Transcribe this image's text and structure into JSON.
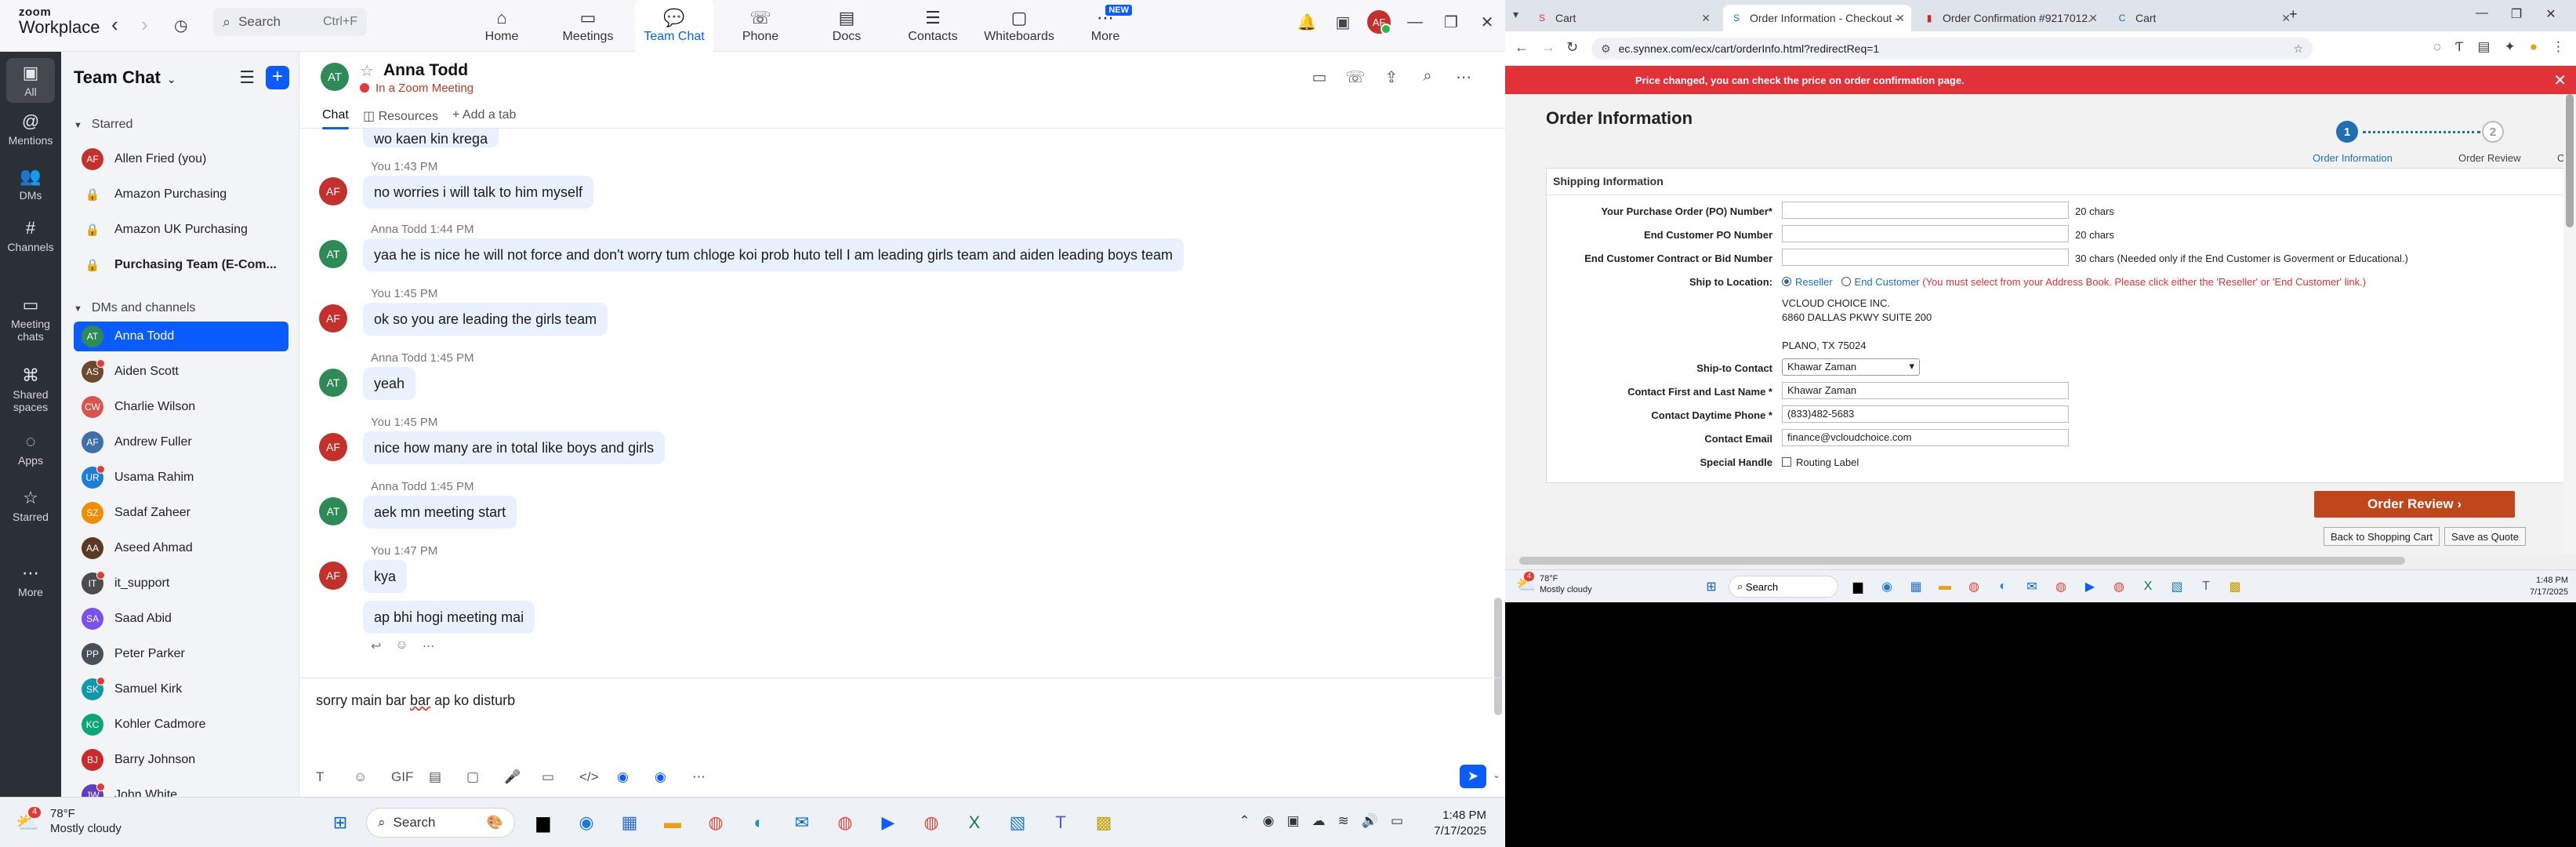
{
  "zoom": {
    "logo_line1": "zoom",
    "logo_line2": "Workplace",
    "search_placeholder": "Search",
    "search_shortcut": "Ctrl+F",
    "nav_tabs": [
      {
        "label": "Home",
        "icon": "⌂"
      },
      {
        "label": "Meetings",
        "icon": "▭"
      },
      {
        "label": "Team Chat",
        "icon": "💬"
      },
      {
        "label": "Phone",
        "icon": "☏"
      },
      {
        "label": "Docs",
        "icon": "▤"
      },
      {
        "label": "Contacts",
        "icon": "☰"
      },
      {
        "label": "Whiteboards",
        "icon": "▢"
      },
      {
        "label": "More",
        "icon": "⋯"
      }
    ],
    "new_badge": "NEW",
    "user_initials": "AF",
    "rail": [
      {
        "label": "All",
        "icon": "▣"
      },
      {
        "label": "Mentions",
        "icon": "@"
      },
      {
        "label": "DMs",
        "icon": "👥"
      },
      {
        "label": "Channels",
        "icon": "#"
      },
      {
        "label": "Meeting chats",
        "icon": "▭"
      },
      {
        "label": "Shared spaces",
        "icon": "⌘"
      },
      {
        "label": "Apps",
        "icon": "◌"
      },
      {
        "label": "Starred",
        "icon": "☆"
      },
      {
        "label": "More",
        "icon": "⋯"
      }
    ],
    "sidebar": {
      "title": "Team Chat",
      "sections": {
        "starred": "Starred",
        "dms": "DMs and channels"
      },
      "starred": [
        {
          "name": "Allen Fried (you)",
          "initials": "AF",
          "color": "#c4302b",
          "type": "avatar"
        },
        {
          "name": "Amazon Purchasing",
          "type": "lock"
        },
        {
          "name": "Amazon UK Purchasing",
          "type": "lock"
        },
        {
          "name": "Purchasing Team (E-Com...",
          "type": "lock",
          "bold": true
        }
      ],
      "dms": [
        {
          "name": "Anna Todd",
          "initials": "AT",
          "color": "#2e8b57",
          "active": true
        },
        {
          "name": "Aiden Scott",
          "initials": "AS",
          "color": "#6b4a2f"
        },
        {
          "name": "Charlie Wilson",
          "initials": "CW",
          "color": "#d9534f"
        },
        {
          "name": "Andrew Fuller",
          "initials": "AF",
          "color": "#3f6fa8"
        },
        {
          "name": "Usama Rahim",
          "initials": "UR",
          "color": "#1c7ed6"
        },
        {
          "name": "Sadaf Zaheer",
          "initials": "SZ",
          "color": "#f08c00"
        },
        {
          "name": "Aseed Ahmad",
          "initials": "AA",
          "color": "#5c3a21"
        },
        {
          "name": "it_support",
          "initials": "IT",
          "color": "#4c4c4c"
        },
        {
          "name": "Saad Abid",
          "initials": "SA",
          "color": "#7950f2"
        },
        {
          "name": "Peter Parker",
          "initials": "PP",
          "color": "#495057"
        },
        {
          "name": "Samuel Kirk",
          "initials": "SK",
          "color": "#1098ad"
        },
        {
          "name": "Kohler Cadmore",
          "initials": "KC",
          "color": "#0ca678"
        },
        {
          "name": "Barry Johnson",
          "initials": "BJ",
          "color": "#c92a2a"
        },
        {
          "name": "John White",
          "initials": "JW",
          "color": "#5f3dc4"
        }
      ]
    },
    "chat": {
      "contact_initials": "AT",
      "contact_name": "Anna Todd",
      "contact_status": "In a Zoom Meeting",
      "tabs": [
        "Chat",
        "Resources",
        "+ Add a tab"
      ],
      "messages": [
        {
          "meta": "",
          "text": "wo kaen kin krega",
          "from": "AT",
          "partial": true
        },
        {
          "meta": "You 1:43 PM",
          "text": "no worries i will talk to him myself",
          "from": "AF"
        },
        {
          "meta": "Anna Todd 1:44 PM",
          "text": "yaa he is nice he will not force and don't worry tum chloge koi prob huto tell I am leading girls team and aiden leading boys team",
          "from": "AT"
        },
        {
          "meta": "You 1:45 PM",
          "text": "ok so you are leading the girls team",
          "from": "AF"
        },
        {
          "meta": "Anna Todd 1:45 PM",
          "text": "yeah",
          "from": "AT"
        },
        {
          "meta": "You 1:45 PM",
          "text": "nice how many are in total like boys and girls",
          "from": "AF"
        },
        {
          "meta": "Anna Todd 1:45 PM",
          "text": "aek mn meeting start",
          "from": "AT"
        },
        {
          "meta": "You 1:47 PM",
          "text": "kya",
          "from": "AF"
        },
        {
          "meta": "",
          "text": "ap bhi hogi meeting mai",
          "from": "AF",
          "continued": true
        }
      ],
      "compose_before": "sorry main bar ",
      "compose_misspelled": "bar",
      "compose_after": " ap ko disturb",
      "compose_tools": [
        "T",
        "☺",
        "GIF",
        "▤",
        "▢",
        "🎤",
        "▭",
        "</>",
        "◉",
        "◉",
        "⋯"
      ]
    },
    "taskbar": {
      "weather_temp": "78°F",
      "weather_desc": "Mostly cloudy",
      "weather_badge": "4",
      "search": "Search",
      "time": "1:48 PM",
      "date": "7/17/2025"
    }
  },
  "browser": {
    "tabs": [
      {
        "title": "Cart",
        "active": false,
        "icon": "S",
        "color": "#e03238"
      },
      {
        "title": "Order Information - Checkout -",
        "active": true,
        "icon": "S",
        "color": "#1f6fb2"
      },
      {
        "title": "Order Confirmation #9217012...",
        "active": false,
        "icon": "▮",
        "color": "#c92a2a"
      },
      {
        "title": "Cart",
        "active": false,
        "icon": "C",
        "color": "#1f6fb2"
      }
    ],
    "url": "ec.synnex.com/ecx/cart/orderInfo.html?redirectReq=1",
    "banner": "Price changed, you can check the price on order confirmation page.",
    "page_title": "Order Information",
    "steps": [
      {
        "num": "1",
        "label": "Order Information"
      },
      {
        "num": "2",
        "label": "Order Review"
      },
      {
        "num": "",
        "label": "O"
      }
    ],
    "section_title": "Shipping Information",
    "fields": {
      "po_label": "Your Purchase Order (PO) Number*",
      "po_hint": "20 chars",
      "end_po_label": "End Customer PO Number",
      "end_po_hint": "20 chars",
      "contract_label": "End Customer Contract or Bid Number",
      "contract_hint": "30 chars (Needed only if the End Customer is Goverment or Educational.)",
      "ship_label": "Ship to Location:",
      "ship_opt1": "Reseller",
      "ship_opt2": "End Customer",
      "ship_note": "(You must select from your Address Book. Please click either the 'Reseller' or 'End Customer' link.)",
      "addr1": "VCLOUD CHOICE INC.",
      "addr2": "6860 DALLAS PKWY SUITE 200",
      "addr3": "PLANO, TX 75024",
      "contact_label": "Ship-to Contact",
      "contact_value": "Khawar Zaman",
      "name_label": "Contact First and Last Name *",
      "name_value": "Khawar Zaman",
      "phone_label": "Contact Daytime Phone *",
      "phone_value": "(833)482-5683",
      "email_label": "Contact Email",
      "email_value": "finance@vcloudchoice.com",
      "handle_label": "Special Handle",
      "handle_value": "Routing Label"
    },
    "btn_review": "Order Review ›",
    "btn_back": "Back to Shopping Cart",
    "btn_quote": "Save as Quote",
    "taskbar": {
      "weather_temp": "78°F",
      "weather_desc": "Mostly cloudy",
      "weather_badge": "4",
      "search": "Search",
      "time": "1:48 PM",
      "date": "7/17/2025"
    }
  }
}
